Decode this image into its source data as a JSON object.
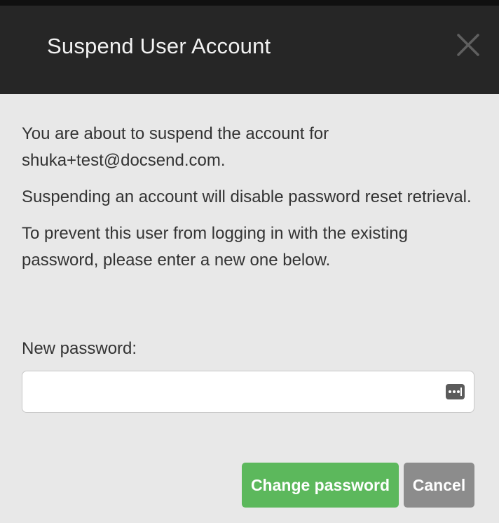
{
  "dialog": {
    "title": "Suspend User Account",
    "close_icon": "close-icon",
    "messages": [
      "You are about to suspend the account for shuka+test@docsend.com.",
      "Suspending an account will disable password reset retrieval.",
      "To prevent this user from logging in with the existing password, please enter a new one below."
    ],
    "password_label": "New password:",
    "password_value": "",
    "password_icon": "password-manager-icon",
    "buttons": {
      "submit": "Change password",
      "cancel": "Cancel"
    }
  },
  "colors": {
    "header_bg": "#262626",
    "body_bg": "#e8e8e8",
    "primary": "#5cb85c",
    "secondary": "#8c8c8c"
  }
}
